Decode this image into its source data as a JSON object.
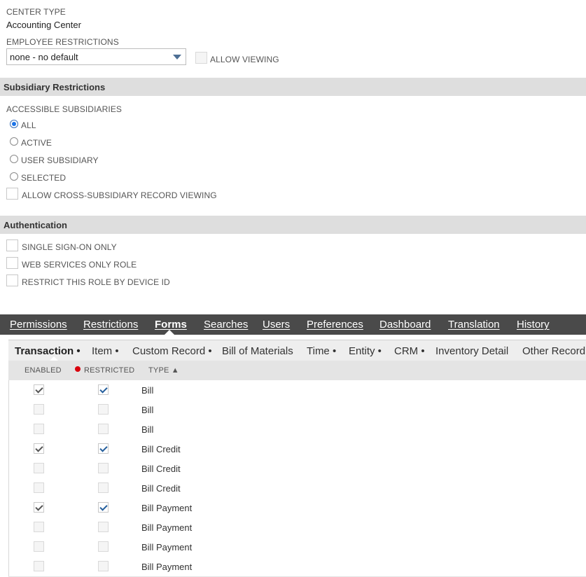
{
  "center_type": {
    "label": "CENTER TYPE",
    "value": "Accounting Center"
  },
  "employee_restrictions": {
    "label": "EMPLOYEE RESTRICTIONS",
    "selected": "none - no default",
    "allow_viewing_label": "ALLOW VIEWING",
    "allow_viewing_checked": false
  },
  "subsidiary_section": {
    "title": "Subsidiary Restrictions",
    "accessible_label": "ACCESSIBLE SUBSIDIARIES",
    "options": [
      {
        "label": "ALL",
        "selected": true
      },
      {
        "label": "ACTIVE",
        "selected": false
      },
      {
        "label": "USER SUBSIDIARY",
        "selected": false
      },
      {
        "label": "SELECTED",
        "selected": false
      }
    ],
    "cross_subsidiary_label": "ALLOW CROSS-SUBSIDIARY RECORD VIEWING"
  },
  "authentication_section": {
    "title": "Authentication",
    "options": [
      {
        "label": "SINGLE SIGN-ON ONLY",
        "checked": false
      },
      {
        "label": "WEB SERVICES ONLY ROLE",
        "checked": false
      },
      {
        "label": "RESTRICT THIS ROLE BY DEVICE ID",
        "checked": false
      }
    ]
  },
  "tabs": [
    "Permissions",
    "Restrictions",
    "Forms",
    "Searches",
    "Users",
    "Preferences",
    "Dashboard",
    "Translation",
    "History"
  ],
  "active_tab": "Forms",
  "subtabs": [
    "Transaction •",
    "Item •",
    "Custom Record •",
    "Bill of Materials",
    "Time •",
    "Entity •",
    "CRM •",
    "Inventory Detail",
    "Other Record"
  ],
  "active_subtab": "Transaction •",
  "grid": {
    "headers": {
      "enabled": "ENABLED",
      "restricted": "RESTRICTED",
      "type": "TYPE ▲"
    },
    "rows": [
      {
        "enabled": true,
        "restricted": true,
        "type": "Bill"
      },
      {
        "enabled": false,
        "restricted": false,
        "type": "Bill"
      },
      {
        "enabled": false,
        "restricted": false,
        "type": "Bill"
      },
      {
        "enabled": true,
        "restricted": true,
        "type": "Bill Credit"
      },
      {
        "enabled": false,
        "restricted": false,
        "type": "Bill Credit"
      },
      {
        "enabled": false,
        "restricted": false,
        "type": "Bill Credit"
      },
      {
        "enabled": true,
        "restricted": true,
        "type": "Bill Payment"
      },
      {
        "enabled": false,
        "restricted": false,
        "type": "Bill Payment"
      },
      {
        "enabled": false,
        "restricted": false,
        "type": "Bill Payment"
      },
      {
        "enabled": false,
        "restricted": false,
        "type": "Bill Payment"
      }
    ]
  },
  "colors": {
    "tab_bar": "#4a4a4a",
    "section_bar": "#dedede",
    "radio_accent": "#1a73e8",
    "required_dot": "#d9000d"
  }
}
